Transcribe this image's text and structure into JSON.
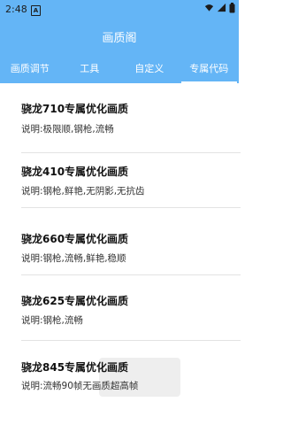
{
  "status_bar": {
    "time": "2:48",
    "badge": "A",
    "icons": [
      "wifi-icon",
      "signal-icon",
      "battery-icon"
    ]
  },
  "app_bar": {
    "title": "画质阁"
  },
  "tabs": [
    {
      "label": "画质调节",
      "active": false
    },
    {
      "label": "工具",
      "active": false
    },
    {
      "label": "自定义",
      "active": false
    },
    {
      "label": "专属代码",
      "active": true
    }
  ],
  "items": [
    {
      "title": "骁龙710专属优化画质",
      "desc": "说明:极限顺,钢枪,流畅"
    },
    {
      "title": "骁龙410专属优化画质",
      "desc": "说明:钢枪,鲜艳,无阴影,无抗齿"
    },
    {
      "title": "骁龙660专属优化画质",
      "desc": "说明:钢枪,流畅,鲜艳,稳顺"
    },
    {
      "title": "骁龙625专属优化画质",
      "desc": "说明:钢枪,流畅"
    },
    {
      "title": "骁龙845专属优化画质",
      "desc": "说明:流畅90帧无画质超高帧"
    }
  ],
  "colors": {
    "primary": "#64b5f6",
    "text": "#111111",
    "divider": "#e3e3e3"
  }
}
